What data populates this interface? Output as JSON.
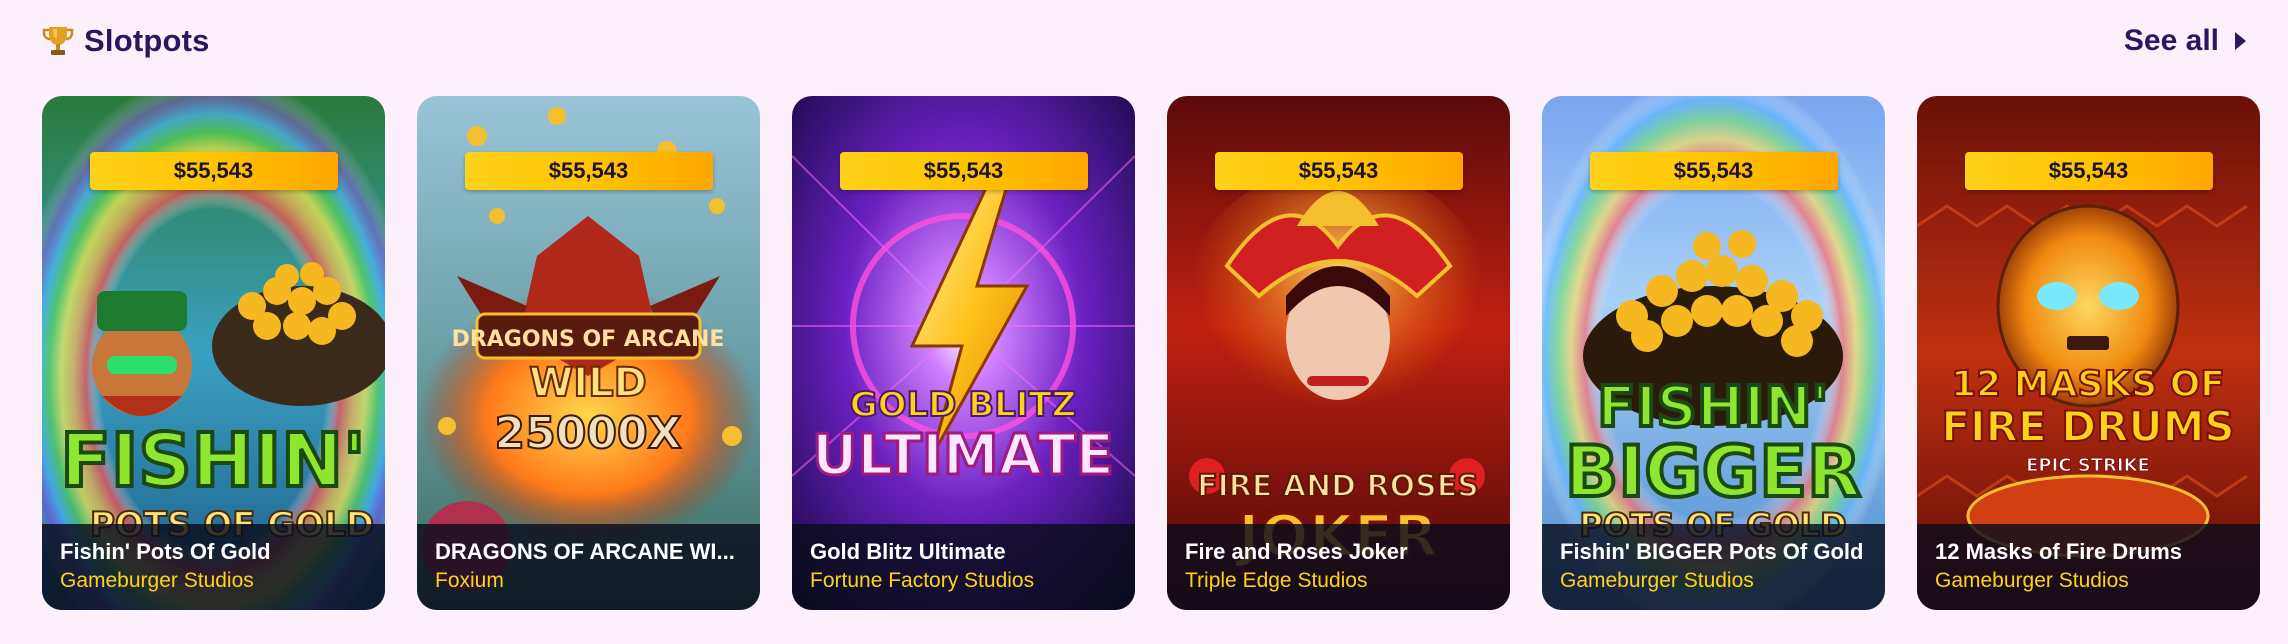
{
  "section": {
    "title": "Slotpots",
    "icon": "trophy-icon",
    "see_all_label": "See all"
  },
  "games": [
    {
      "jackpot": "$55,543",
      "name": "Fishin' Pots Of Gold",
      "provider": "Gameburger Studios",
      "logo": [
        "FISHIN'",
        "POTS OF GOLD"
      ]
    },
    {
      "jackpot": "$55,543",
      "name": "DRAGONS OF ARCANE WI...",
      "provider": "Foxium",
      "logo": [
        "DRAGONS OF ARCANE",
        "WILD",
        "25000X"
      ]
    },
    {
      "jackpot": "$55,543",
      "name": "Gold Blitz Ultimate",
      "provider": "Fortune Factory Studios",
      "logo": [
        "GOLD BLITZ",
        "ULTIMATE"
      ]
    },
    {
      "jackpot": "$55,543",
      "name": "Fire and Roses Joker",
      "provider": "Triple Edge Studios",
      "logo": [
        "FIRE AND ROSES",
        "JOKER"
      ]
    },
    {
      "jackpot": "$55,543",
      "name": "Fishin' BIGGER Pots Of Gold",
      "provider": "Gameburger Studios",
      "logo": [
        "FISHIN'",
        "BIGGER",
        "POTS OF GOLD"
      ]
    },
    {
      "jackpot": "$55,543",
      "name": "12 Masks of Fire Drums",
      "provider": "Gameburger Studios",
      "logo": [
        "12 MASKS OF",
        "FIRE DRUMS",
        "EPIC STRIKE"
      ]
    }
  ],
  "colors": {
    "page_bg": "#fbf0fb",
    "title": "#2b1660",
    "jackpot_badge": "#ffc400",
    "provider_text": "#ffd21a"
  }
}
